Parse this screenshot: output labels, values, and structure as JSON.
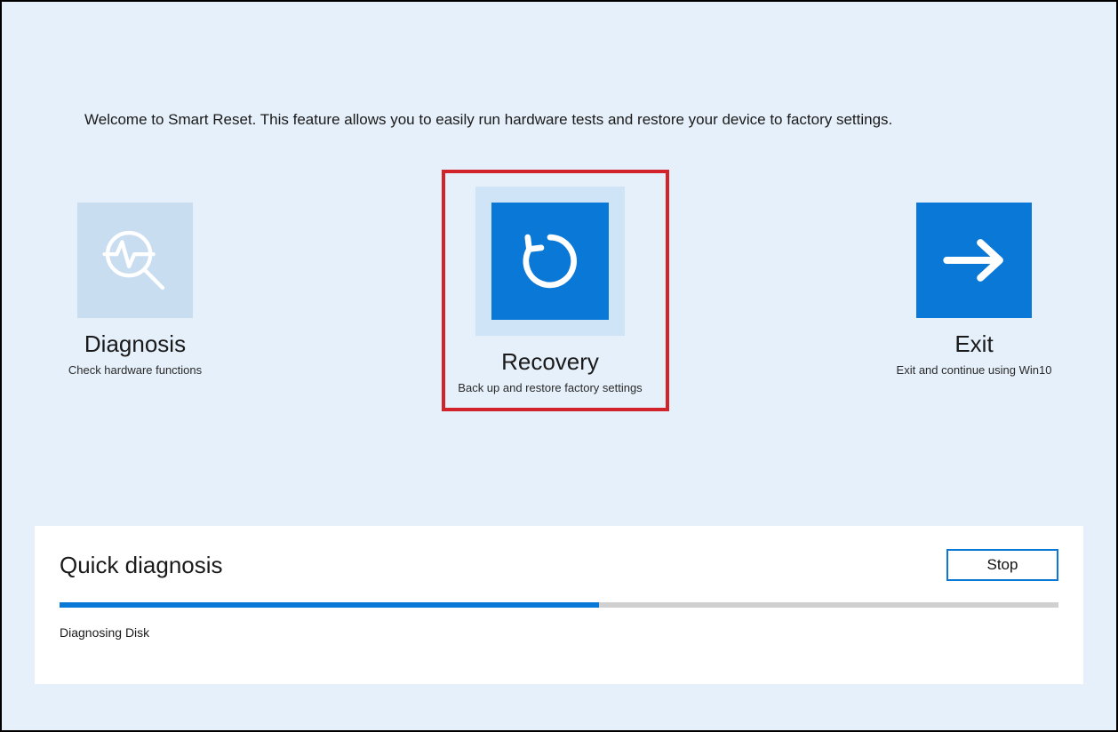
{
  "welcome_text": "Welcome to Smart Reset. This feature allows you to easily run hardware tests and restore your device to factory settings.",
  "tiles": {
    "diagnosis": {
      "title": "Diagnosis",
      "subtitle": "Check hardware functions"
    },
    "recovery": {
      "title": "Recovery",
      "subtitle": "Back up and restore factory settings"
    },
    "exit": {
      "title": "Exit",
      "subtitle": "Exit and continue using Win10"
    }
  },
  "panel": {
    "heading": "Quick diagnosis",
    "stop_label": "Stop",
    "status_text": "Diagnosing Disk",
    "progress_percent": 54
  },
  "colors": {
    "page_bg": "#e6f0fa",
    "tile_light": "#c9ddf0",
    "tile_blue": "#0a78d6",
    "highlight": "#d2232a"
  }
}
